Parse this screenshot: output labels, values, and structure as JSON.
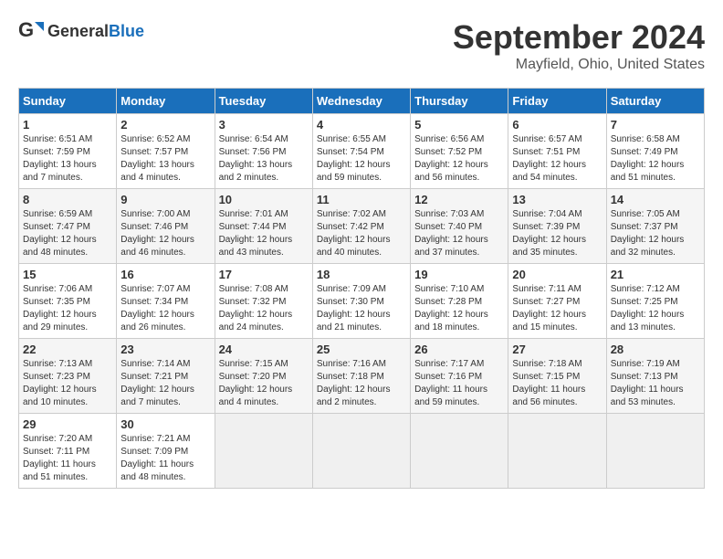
{
  "header": {
    "logo_general": "General",
    "logo_blue": "Blue",
    "title": "September 2024",
    "subtitle": "Mayfield, Ohio, United States"
  },
  "calendar": {
    "columns": [
      "Sunday",
      "Monday",
      "Tuesday",
      "Wednesday",
      "Thursday",
      "Friday",
      "Saturday"
    ],
    "rows": [
      [
        {
          "day": "1",
          "sunrise": "Sunrise: 6:51 AM",
          "sunset": "Sunset: 7:59 PM",
          "daylight": "Daylight: 13 hours and 7 minutes."
        },
        {
          "day": "2",
          "sunrise": "Sunrise: 6:52 AM",
          "sunset": "Sunset: 7:57 PM",
          "daylight": "Daylight: 13 hours and 4 minutes."
        },
        {
          "day": "3",
          "sunrise": "Sunrise: 6:54 AM",
          "sunset": "Sunset: 7:56 PM",
          "daylight": "Daylight: 13 hours and 2 minutes."
        },
        {
          "day": "4",
          "sunrise": "Sunrise: 6:55 AM",
          "sunset": "Sunset: 7:54 PM",
          "daylight": "Daylight: 12 hours and 59 minutes."
        },
        {
          "day": "5",
          "sunrise": "Sunrise: 6:56 AM",
          "sunset": "Sunset: 7:52 PM",
          "daylight": "Daylight: 12 hours and 56 minutes."
        },
        {
          "day": "6",
          "sunrise": "Sunrise: 6:57 AM",
          "sunset": "Sunset: 7:51 PM",
          "daylight": "Daylight: 12 hours and 54 minutes."
        },
        {
          "day": "7",
          "sunrise": "Sunrise: 6:58 AM",
          "sunset": "Sunset: 7:49 PM",
          "daylight": "Daylight: 12 hours and 51 minutes."
        }
      ],
      [
        {
          "day": "8",
          "sunrise": "Sunrise: 6:59 AM",
          "sunset": "Sunset: 7:47 PM",
          "daylight": "Daylight: 12 hours and 48 minutes."
        },
        {
          "day": "9",
          "sunrise": "Sunrise: 7:00 AM",
          "sunset": "Sunset: 7:46 PM",
          "daylight": "Daylight: 12 hours and 46 minutes."
        },
        {
          "day": "10",
          "sunrise": "Sunrise: 7:01 AM",
          "sunset": "Sunset: 7:44 PM",
          "daylight": "Daylight: 12 hours and 43 minutes."
        },
        {
          "day": "11",
          "sunrise": "Sunrise: 7:02 AM",
          "sunset": "Sunset: 7:42 PM",
          "daylight": "Daylight: 12 hours and 40 minutes."
        },
        {
          "day": "12",
          "sunrise": "Sunrise: 7:03 AM",
          "sunset": "Sunset: 7:40 PM",
          "daylight": "Daylight: 12 hours and 37 minutes."
        },
        {
          "day": "13",
          "sunrise": "Sunrise: 7:04 AM",
          "sunset": "Sunset: 7:39 PM",
          "daylight": "Daylight: 12 hours and 35 minutes."
        },
        {
          "day": "14",
          "sunrise": "Sunrise: 7:05 AM",
          "sunset": "Sunset: 7:37 PM",
          "daylight": "Daylight: 12 hours and 32 minutes."
        }
      ],
      [
        {
          "day": "15",
          "sunrise": "Sunrise: 7:06 AM",
          "sunset": "Sunset: 7:35 PM",
          "daylight": "Daylight: 12 hours and 29 minutes."
        },
        {
          "day": "16",
          "sunrise": "Sunrise: 7:07 AM",
          "sunset": "Sunset: 7:34 PM",
          "daylight": "Daylight: 12 hours and 26 minutes."
        },
        {
          "day": "17",
          "sunrise": "Sunrise: 7:08 AM",
          "sunset": "Sunset: 7:32 PM",
          "daylight": "Daylight: 12 hours and 24 minutes."
        },
        {
          "day": "18",
          "sunrise": "Sunrise: 7:09 AM",
          "sunset": "Sunset: 7:30 PM",
          "daylight": "Daylight: 12 hours and 21 minutes."
        },
        {
          "day": "19",
          "sunrise": "Sunrise: 7:10 AM",
          "sunset": "Sunset: 7:28 PM",
          "daylight": "Daylight: 12 hours and 18 minutes."
        },
        {
          "day": "20",
          "sunrise": "Sunrise: 7:11 AM",
          "sunset": "Sunset: 7:27 PM",
          "daylight": "Daylight: 12 hours and 15 minutes."
        },
        {
          "day": "21",
          "sunrise": "Sunrise: 7:12 AM",
          "sunset": "Sunset: 7:25 PM",
          "daylight": "Daylight: 12 hours and 13 minutes."
        }
      ],
      [
        {
          "day": "22",
          "sunrise": "Sunrise: 7:13 AM",
          "sunset": "Sunset: 7:23 PM",
          "daylight": "Daylight: 12 hours and 10 minutes."
        },
        {
          "day": "23",
          "sunrise": "Sunrise: 7:14 AM",
          "sunset": "Sunset: 7:21 PM",
          "daylight": "Daylight: 12 hours and 7 minutes."
        },
        {
          "day": "24",
          "sunrise": "Sunrise: 7:15 AM",
          "sunset": "Sunset: 7:20 PM",
          "daylight": "Daylight: 12 hours and 4 minutes."
        },
        {
          "day": "25",
          "sunrise": "Sunrise: 7:16 AM",
          "sunset": "Sunset: 7:18 PM",
          "daylight": "Daylight: 12 hours and 2 minutes."
        },
        {
          "day": "26",
          "sunrise": "Sunrise: 7:17 AM",
          "sunset": "Sunset: 7:16 PM",
          "daylight": "Daylight: 11 hours and 59 minutes."
        },
        {
          "day": "27",
          "sunrise": "Sunrise: 7:18 AM",
          "sunset": "Sunset: 7:15 PM",
          "daylight": "Daylight: 11 hours and 56 minutes."
        },
        {
          "day": "28",
          "sunrise": "Sunrise: 7:19 AM",
          "sunset": "Sunset: 7:13 PM",
          "daylight": "Daylight: 11 hours and 53 minutes."
        }
      ],
      [
        {
          "day": "29",
          "sunrise": "Sunrise: 7:20 AM",
          "sunset": "Sunset: 7:11 PM",
          "daylight": "Daylight: 11 hours and 51 minutes."
        },
        {
          "day": "30",
          "sunrise": "Sunrise: 7:21 AM",
          "sunset": "Sunset: 7:09 PM",
          "daylight": "Daylight: 11 hours and 48 minutes."
        },
        null,
        null,
        null,
        null,
        null
      ]
    ]
  }
}
